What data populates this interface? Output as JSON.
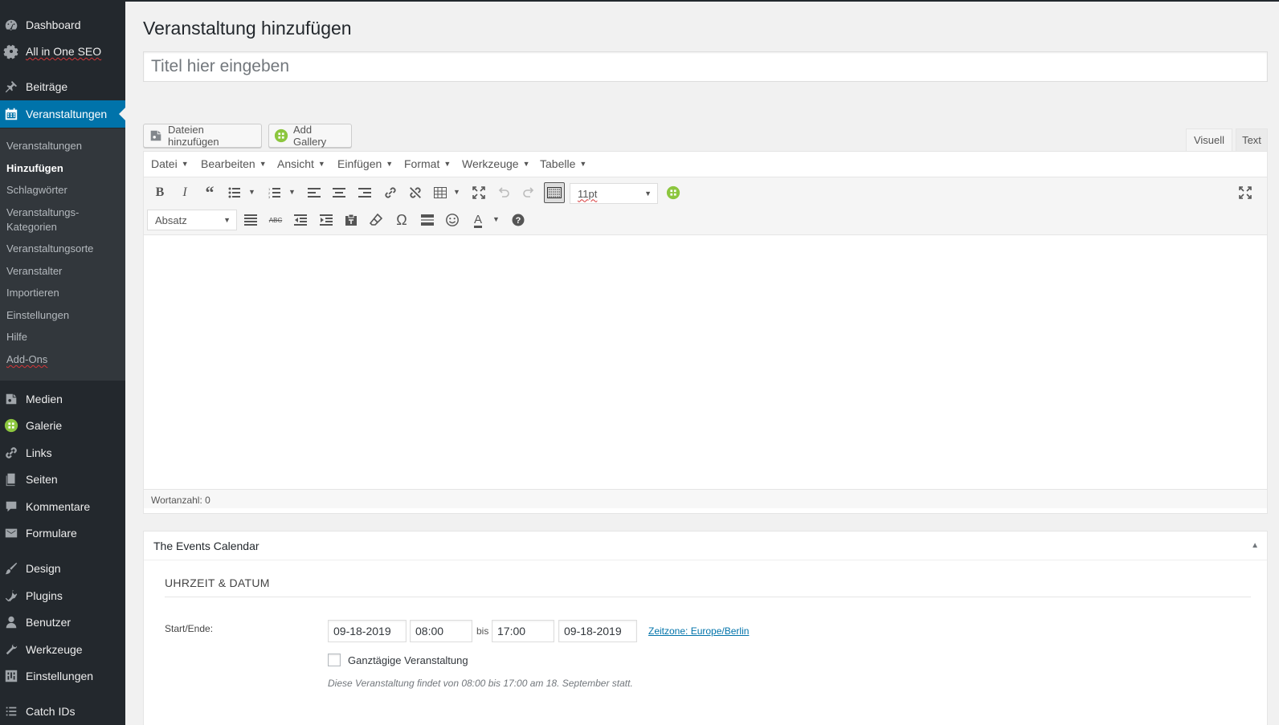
{
  "sidebar": {
    "top_items": [
      {
        "label": "Dashboard",
        "icon": "dashboard-icon"
      },
      {
        "label": "All in One SEO",
        "icon": "gear-icon"
      },
      {
        "label": "Beiträge",
        "icon": "pin-icon"
      },
      {
        "label": "Veranstaltungen",
        "icon": "calendar-icon"
      }
    ],
    "submenu": [
      {
        "label": "Veranstaltungen"
      },
      {
        "label": "Hinzufügen"
      },
      {
        "label": "Schlagwörter"
      },
      {
        "label": "Veranstaltungs-"
      },
      {
        "label": "Kategorien"
      },
      {
        "label": "Veranstaltungsorte"
      },
      {
        "label": "Veranstalter"
      },
      {
        "label": "Importieren"
      },
      {
        "label": "Einstellungen"
      },
      {
        "label": "Hilfe"
      },
      {
        "label": "Add-Ons"
      }
    ],
    "bottom_items": [
      {
        "label": "Medien",
        "icon": "media-icon"
      },
      {
        "label": "Galerie",
        "icon": "gallery-icon"
      },
      {
        "label": "Links",
        "icon": "link-icon"
      },
      {
        "label": "Seiten",
        "icon": "pages-icon"
      },
      {
        "label": "Kommentare",
        "icon": "comment-icon"
      },
      {
        "label": "Formulare",
        "icon": "mail-icon"
      },
      {
        "label": "Design",
        "icon": "brush-icon"
      },
      {
        "label": "Plugins",
        "icon": "plugin-icon"
      },
      {
        "label": "Benutzer",
        "icon": "user-icon"
      },
      {
        "label": "Werkzeuge",
        "icon": "wrench-icon"
      },
      {
        "label": "Einstellungen",
        "icon": "settings-icon"
      },
      {
        "label": "Catch IDs",
        "icon": "list-icon"
      }
    ]
  },
  "page": {
    "title": "Veranstaltung hinzufügen",
    "title_placeholder": "Titel hier eingeben"
  },
  "media": {
    "add_files": "Dateien hinzufügen",
    "add_gallery": "Add Gallery"
  },
  "editor": {
    "tabs": {
      "visual": "Visuell",
      "text": "Text"
    },
    "menubar": [
      "Datei",
      "Bearbeiten",
      "Ansicht",
      "Einfügen",
      "Format",
      "Werkzeuge",
      "Tabelle"
    ],
    "font_size": "11pt",
    "block_format": "Absatz",
    "word_count": "Wortanzahl: 0"
  },
  "events_calendar": {
    "box_title": "The Events Calendar",
    "section_title": "UHRZEIT & DATUM",
    "start_end_label": "Start/Ende:",
    "start_date": "09-18-2019",
    "start_time": "08:00",
    "bis": "bis",
    "end_time": "17:00",
    "end_date": "09-18-2019",
    "timezone_link": "Zeitzone: Europe/Berlin",
    "all_day_label": "Ganztägige Veranstaltung",
    "hint": "Diese Veranstaltung findet von 08:00 bis 17:00 am 18. September statt."
  },
  "colors": {
    "sidebar_bg": "#23282d",
    "submenu_bg": "#32373c",
    "accent": "#0073aa",
    "gallery_green": "#8cc63e"
  }
}
